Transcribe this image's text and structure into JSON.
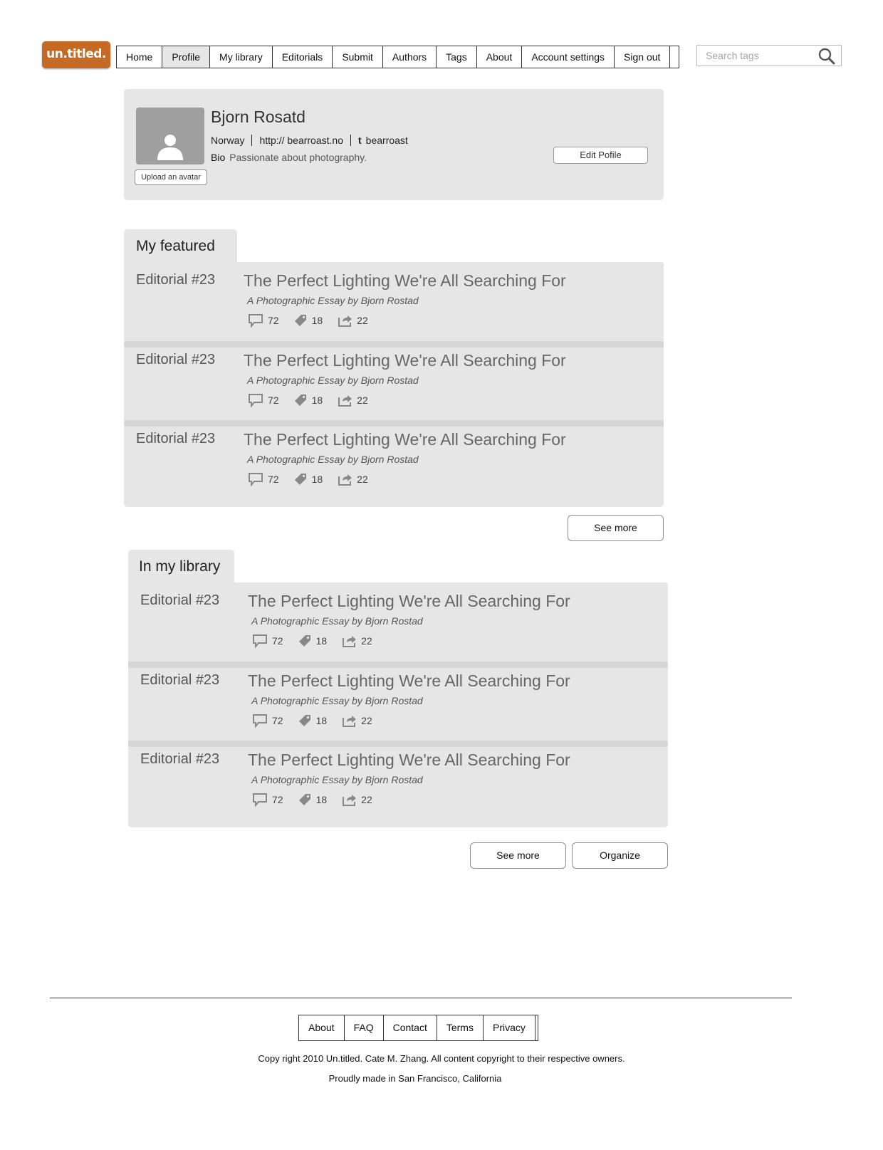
{
  "header": {
    "logo_text": "un.titled.",
    "nav": [
      {
        "label": "Home",
        "active": false
      },
      {
        "label": "Profile",
        "active": true
      },
      {
        "label": "My library",
        "active": false
      },
      {
        "label": "Editorials",
        "active": false
      },
      {
        "label": "Submit",
        "active": false
      },
      {
        "label": "Authors",
        "active": false
      },
      {
        "label": "Tags",
        "active": false
      },
      {
        "label": "About",
        "active": false
      },
      {
        "label": "Account settings",
        "active": false
      },
      {
        "label": "Sign out",
        "active": false
      }
    ],
    "search": {
      "placeholder": "Search tags",
      "icon": "magnifier-icon"
    }
  },
  "profile": {
    "name": "Bjorn Rosatd",
    "country": "Norway",
    "website": "http:// bearroast.no",
    "twitter_icon": "twitter-icon",
    "twitter_handle": "bearroast",
    "bio_label": "Bio",
    "bio": "Passionate about photography.",
    "upload_avatar_label": "Upload an avatar",
    "edit_profile_label": "Edit Pofile"
  },
  "featured": {
    "title": "My featured",
    "items": [
      {
        "editorial": "Editorial #23",
        "title": "The Perfect Lighting We're All Searching For",
        "subtitle": "A Photographic Essay by Bjorn Rostad",
        "comments": "72",
        "tags": "18",
        "shares": "22"
      },
      {
        "editorial": "Editorial #23",
        "title": "The Perfect Lighting We're All Searching For",
        "subtitle": "A Photographic Essay by Bjorn Rostad",
        "comments": "72",
        "tags": "18",
        "shares": "22"
      },
      {
        "editorial": "Editorial #23",
        "title": "The Perfect Lighting We're All Searching For",
        "subtitle": "A Photographic Essay by Bjorn Rostad",
        "comments": "72",
        "tags": "18",
        "shares": "22"
      }
    ],
    "see_more_label": "See more"
  },
  "library": {
    "title": "In my library",
    "items": [
      {
        "editorial": "Editorial #23",
        "title": "The Perfect Lighting We're All Searching For",
        "subtitle": "A Photographic Essay by Bjorn Rostad",
        "comments": "72",
        "tags": "18",
        "shares": "22"
      },
      {
        "editorial": "Editorial #23",
        "title": "The Perfect Lighting We're All Searching For",
        "subtitle": "A Photographic Essay by Bjorn Rostad",
        "comments": "72",
        "tags": "18",
        "shares": "22"
      },
      {
        "editorial": "Editorial #23",
        "title": "The Perfect Lighting We're All Searching For",
        "subtitle": "A Photographic Essay by Bjorn Rostad",
        "comments": "72",
        "tags": "18",
        "shares": "22"
      }
    ],
    "see_more_label": "See more",
    "organize_label": "Organize"
  },
  "footer": {
    "links": [
      "About",
      "FAQ",
      "Contact",
      "Terms",
      "Privacy"
    ],
    "copyright": "Copy right 2010 Un.titled. Cate M. Zhang. All content copyright to their respective owners.",
    "made_in": "Proudly made in San Francisco, California"
  },
  "colors": {
    "brand": "#c46a24",
    "panel": "#e6e6e6",
    "avatar": "#9f9f9f"
  }
}
